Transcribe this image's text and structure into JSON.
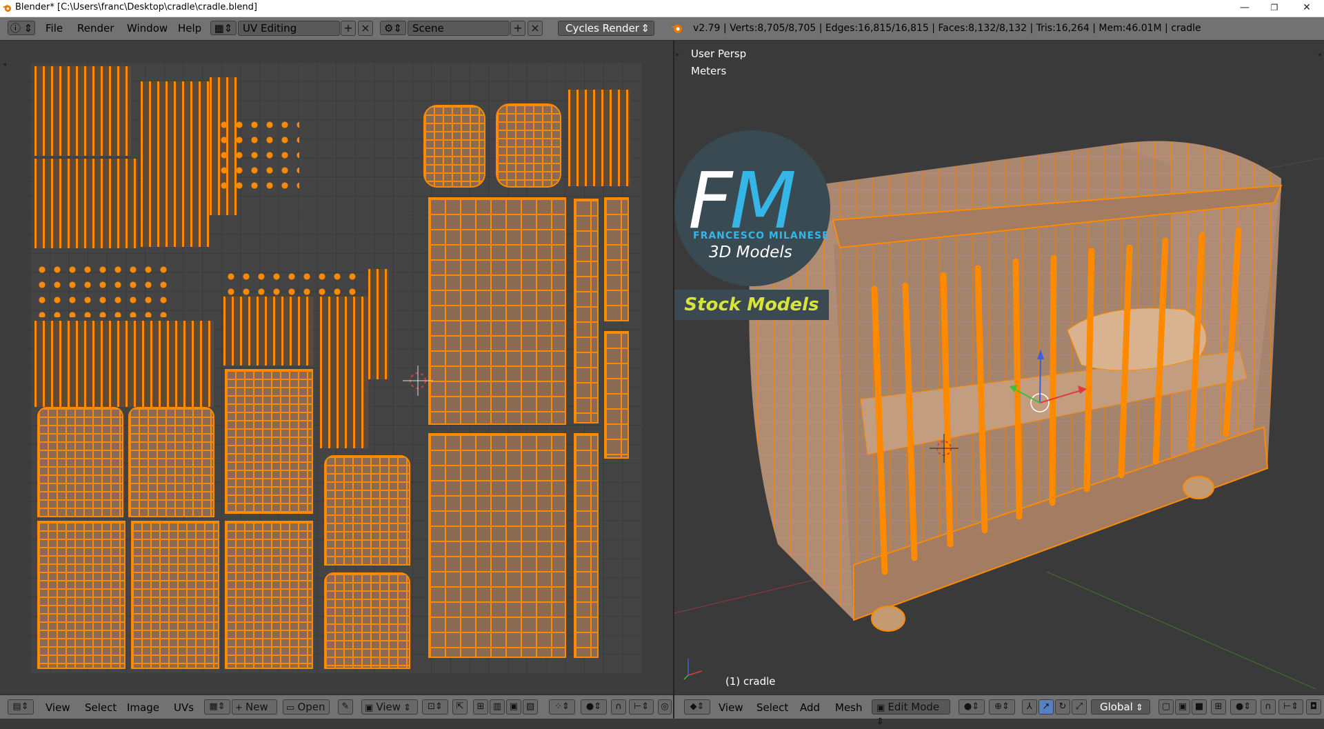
{
  "titlebar": {
    "title": "Blender* [C:\\Users\\franc\\Desktop\\cradle\\cradle.blend]",
    "minimize": "—",
    "restore": "❐",
    "close": "✕"
  },
  "infobar": {
    "menus": [
      "File",
      "Render",
      "Window",
      "Help"
    ],
    "screen_layout": "UV Editing",
    "scene": "Scene",
    "render_engine": "Cycles Render",
    "stats": "v2.79 | Verts:8,705/8,705 | Edges:16,815/16,815 | Faces:8,132/8,132 | Tris:16,264 | Mem:46.01M | cradle"
  },
  "viewport": {
    "view_name": "User Persp",
    "units": "Meters",
    "object_label": "(1) cradle"
  },
  "logo": {
    "initials": "FM",
    "name": "FRANCESCO MILANESE",
    "subtitle": "3D Models",
    "banner": "Stock Models"
  },
  "uv_header": {
    "menus": [
      "View",
      "Select",
      "Image",
      "UVs"
    ],
    "new_label": "New",
    "open_label": "Open",
    "view_label": "View"
  },
  "view3d_header": {
    "menus": [
      "View",
      "Select",
      "Add",
      "Mesh"
    ],
    "mode": "Edit Mode",
    "orientation": "Global"
  },
  "colors": {
    "selection": "#ff8a00",
    "header": "#727272",
    "logo_blue": "#36b6e6",
    "logo_yellow": "#d7e43a"
  }
}
